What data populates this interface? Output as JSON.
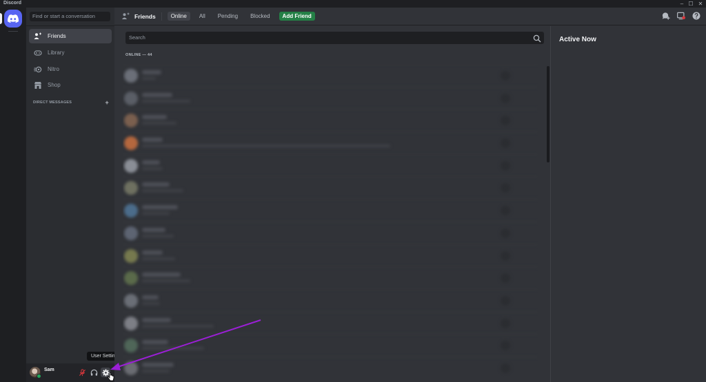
{
  "window": {
    "title": "Discord",
    "controls": [
      "–",
      "☐",
      "✕"
    ]
  },
  "sidebar": {
    "search_placeholder": "Find or start a conversation",
    "items": [
      {
        "label": "Friends",
        "icon": "friends-icon",
        "active": true
      },
      {
        "label": "Library",
        "icon": "library-icon",
        "active": false
      },
      {
        "label": "Nitro",
        "icon": "nitro-icon",
        "active": false
      },
      {
        "label": "Shop",
        "icon": "shop-icon",
        "active": false
      }
    ],
    "dm_header": "DIRECT MESSAGES",
    "dm_add": "+"
  },
  "user_panel": {
    "username": "Sam",
    "tooltip": "User Settings"
  },
  "topbar": {
    "title": "Friends",
    "tabs": [
      {
        "label": "Online",
        "active": true
      },
      {
        "label": "All",
        "active": false
      },
      {
        "label": "Pending",
        "active": false
      },
      {
        "label": "Blocked",
        "active": false
      }
    ],
    "add_friend": "Add Friend"
  },
  "friends": {
    "search_placeholder": "Search",
    "online_header": "ONLINE — 44"
  },
  "active_now": {
    "title": "Active Now"
  },
  "colors": {
    "brand": "#5865f2",
    "add_friend_green": "#248046",
    "annotation_arrow": "#9b1fd6",
    "mute_red": "#da373c"
  }
}
